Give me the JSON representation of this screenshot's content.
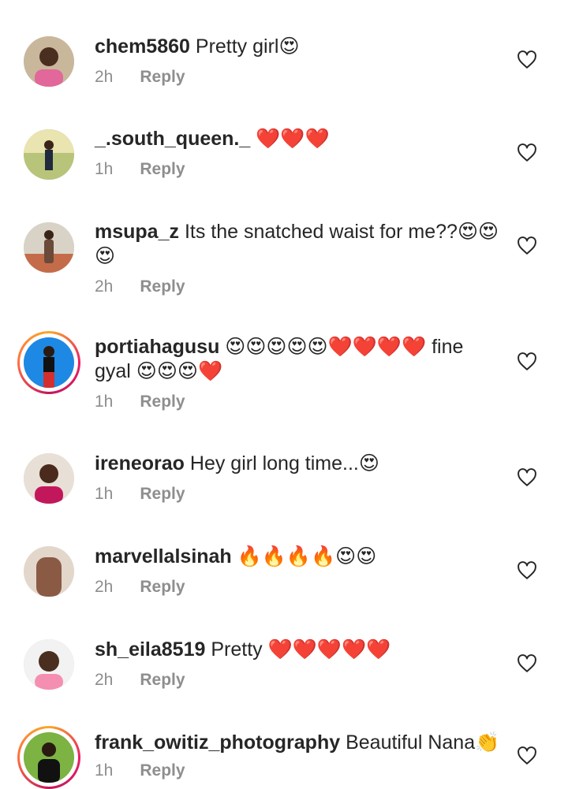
{
  "comments": [
    {
      "username": "chem5860",
      "text": "Pretty girl😍",
      "time": "2h",
      "reply": "Reply",
      "ring": false
    },
    {
      "username": "_.south_queen._",
      "text": "❤️❤️❤️",
      "time": "1h",
      "reply": "Reply",
      "ring": false
    },
    {
      "username": "msupa_z",
      "text": "Its the snatched waist for me??😍😍😍",
      "time": "2h",
      "reply": "Reply",
      "ring": false
    },
    {
      "username": "portiahagusu",
      "text": "😍😍😍😍😍❤️❤️❤️❤️ fine gyal 😍😍😍❤️",
      "time": "1h",
      "reply": "Reply",
      "ring": true
    },
    {
      "username": "ireneorao",
      "text": "Hey girl long time...😍",
      "time": "1h",
      "reply": "Reply",
      "ring": false
    },
    {
      "username": "marvellalsinah",
      "text": "🔥🔥🔥🔥😍😍",
      "time": "2h",
      "reply": "Reply",
      "ring": false
    },
    {
      "username": "sh_eila8519",
      "text": "Pretty ❤️❤️❤️❤️❤️",
      "time": "2h",
      "reply": "Reply",
      "ring": false
    },
    {
      "username": "frank_owitiz_photography",
      "text": "Beautiful Nana👏",
      "time": "1h",
      "reply": "Reply",
      "ring": true
    }
  ],
  "icons": {
    "like": "heart-outline-icon"
  },
  "colors": {
    "text": "#262626",
    "secondary": "#8e8e8e",
    "story_ring": "#e91e63"
  }
}
